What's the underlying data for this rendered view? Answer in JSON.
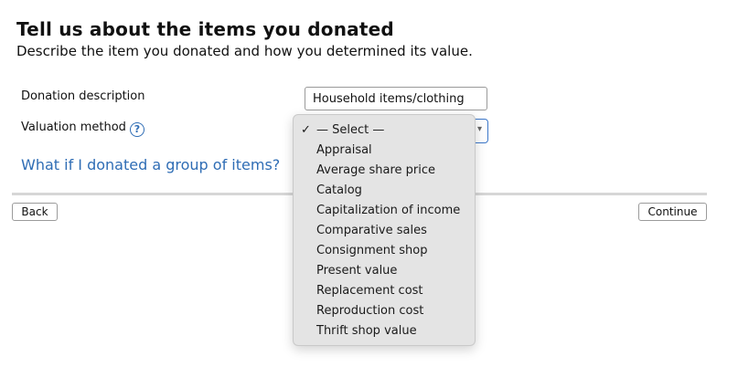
{
  "page": {
    "title": "Tell us about the items you donated",
    "subtitle": "Describe the item you donated and how you determined its value."
  },
  "form": {
    "description_label": "Donation description",
    "description_value": "Household items/clothing",
    "valuation_label": "Valuation method",
    "help_icon": "question-circle-icon",
    "help_glyph": "?",
    "selected_value": "— Select —"
  },
  "link": {
    "group_items": "What if I donated a group of items?"
  },
  "buttons": {
    "back": "Back",
    "continue": "Continue"
  },
  "dropdown": {
    "check_glyph": "✓",
    "options": [
      "— Select —",
      "Appraisal",
      "Average share price",
      "Catalog",
      "Capitalization of income",
      "Comparative sales",
      "Consignment shop",
      "Present value",
      "Replacement cost",
      "Reproduction cost",
      "Thrift shop value"
    ]
  },
  "colors": {
    "link": "#2f6db5",
    "focus_border": "#3b76c8",
    "menu_bg": "#e4e4e4"
  }
}
